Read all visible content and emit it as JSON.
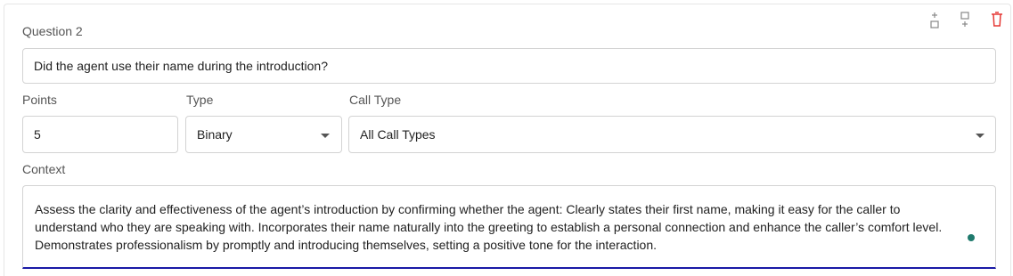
{
  "question": {
    "title": "Question 2",
    "text": "Did the agent use their name during the introduction?"
  },
  "fields": {
    "points_label": "Points",
    "points_value": "5",
    "type_label": "Type",
    "type_value": "Binary",
    "call_type_label": "Call Type",
    "call_type_value": "All Call Types",
    "context_label": "Context",
    "context_value": "Assess the clarity and effectiveness of the agent’s introduction by confirming whether the agent:  Clearly states their first name, making it easy for the caller to understand who they are speaking with. Incorporates their name naturally into the greeting to establish a personal connection and enhance the caller’s comfort level. Demonstrates professionalism by promptly and introducing themselves, setting a positive tone for the interaction."
  },
  "toolbar": {
    "icons": [
      "insert-above-icon",
      "insert-below-icon",
      "trash-icon"
    ]
  },
  "colors": {
    "delete": "#e53935",
    "focus_underline": "#1a1aa6",
    "status_dot": "#1f7a6d"
  }
}
